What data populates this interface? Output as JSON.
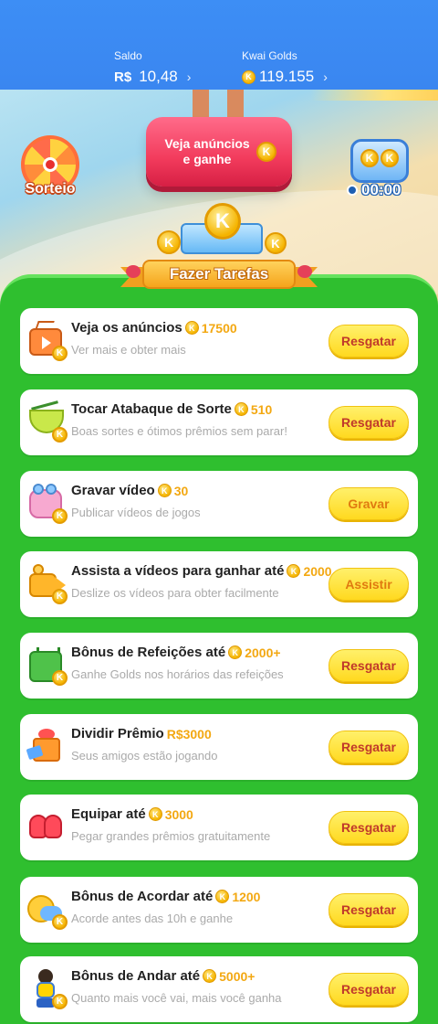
{
  "header": {
    "saldo_label": "Saldo",
    "saldo_currency": "R$",
    "saldo_value": "10,48",
    "golds_label": "Kwai Golds",
    "golds_value": "119.155",
    "chevron": "›",
    "colors": {
      "header_bg": "#3d8ef5",
      "coin": "#f5b400"
    }
  },
  "banner": {
    "sorteio_label": "Sorteio",
    "ads_button_label": "Veja anúncios e ganhe",
    "timer_value": "00:00",
    "coin_letter": "K",
    "ribbon_label": "Fazer Tarefas"
  },
  "tasks": [
    {
      "title": "Veja os anúncios",
      "reward": "17500",
      "reward_kind": "coin",
      "subtitle": "Ver mais e obter mais",
      "button": "Resgatar",
      "icon": "tv-icon"
    },
    {
      "title": "Tocar Atabaque de Sorte",
      "reward": "510",
      "reward_kind": "coin",
      "subtitle": "Boas sortes e ótimos prêmios sem parar!",
      "button": "Resgatar",
      "icon": "drum-icon"
    },
    {
      "title": "Gravar vídeo",
      "reward": "30",
      "reward_kind": "coin",
      "subtitle": "Publicar vídeos de jogos",
      "button": "Gravar",
      "icon": "camera-icon"
    },
    {
      "title": "Assista a vídeos para ganhar até",
      "reward": "2000",
      "reward_kind": "coin",
      "subtitle": "Deslize os vídeos para obter facilmente",
      "button": "Assistir",
      "icon": "video-camera-icon"
    },
    {
      "title": "Bônus de Refeições até",
      "reward": "2000+",
      "reward_kind": "coin",
      "subtitle": "Ganhe Golds nos horários das refeições",
      "button": "Resgatar",
      "icon": "calendar-icon"
    },
    {
      "title": "Dividir Prêmio",
      "reward": "R$3000",
      "reward_kind": "cash",
      "subtitle": "Seus amigos estão jogando",
      "button": "Resgatar",
      "icon": "gift-icon"
    },
    {
      "title": "Equipar até",
      "reward": "3000",
      "reward_kind": "coin",
      "subtitle": "Pegar grandes prêmios gratuitamente",
      "button": "Resgatar",
      "icon": "boxing-glove-icon"
    },
    {
      "title": "Bônus de Acordar até",
      "reward": "1200",
      "reward_kind": "coin",
      "subtitle": "Acorde antes das 10h e ganhe",
      "button": "Resgatar",
      "icon": "moon-icon"
    },
    {
      "title": "Bônus de Andar até",
      "reward": "5000+",
      "reward_kind": "coin",
      "subtitle": "Quanto mais você vai, mais você ganha",
      "button": "Resgatar",
      "icon": "runner-icon"
    }
  ],
  "colors": {
    "panel_green": "#2fbf2f",
    "button_yellow": "#ffd91f",
    "button_text_red": "#c0392b",
    "reward_orange": "#f3a812",
    "ads_button_red": "#f23b5c"
  }
}
